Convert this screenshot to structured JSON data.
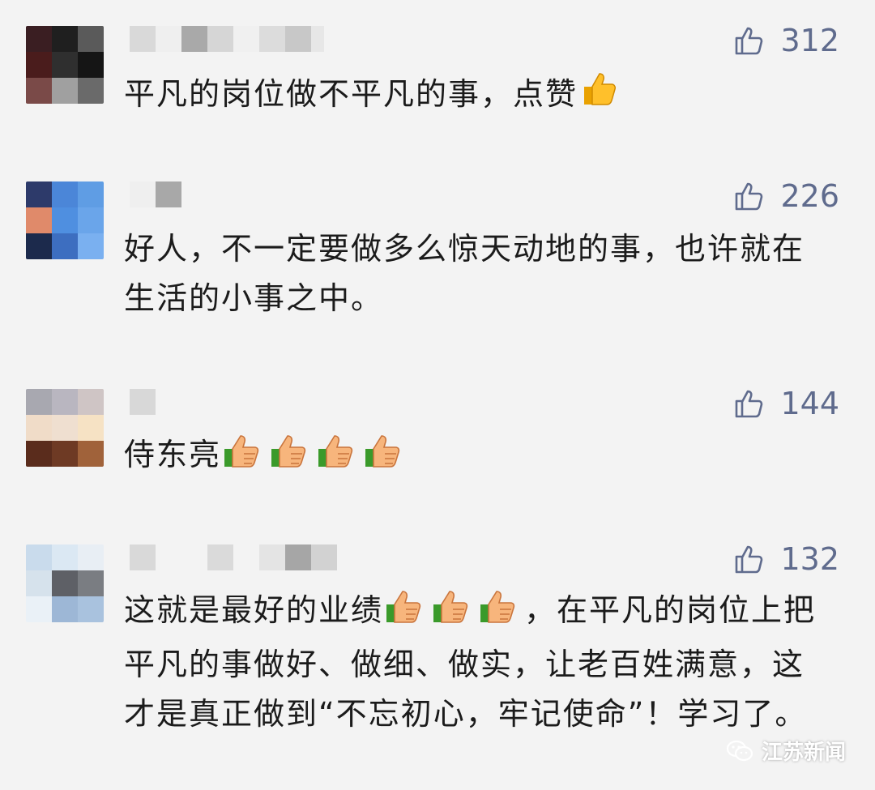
{
  "comments": [
    {
      "likes": "312",
      "text": "平凡的岗位做不平凡的事，点赞",
      "thumbs": 1,
      "thumb_style": "gold"
    },
    {
      "likes": "226",
      "text": "好人，不一定要做多么惊天动地的事，也许就在生活的小事之中。",
      "thumbs": 0
    },
    {
      "likes": "144",
      "text": "侍东亮",
      "thumbs": 4,
      "thumb_style": "cuff"
    },
    {
      "likes": "132",
      "text_before": "这就是最好的业绩",
      "thumbs": 3,
      "thumb_style": "cuff",
      "text_after": "，在平凡的岗位上把平凡的事做好、做细、做实，让老百姓满意，这才是真正做到“不忘初心，牢记使命”！学习了。"
    }
  ],
  "watermark": {
    "label": "江苏新闻",
    "icon": "wechat-icon"
  },
  "icons": {
    "like": "thumbs-up-outline-icon"
  },
  "colors": {
    "background": "#f3f3f3",
    "like_text": "#5f6b8d",
    "body_text": "#1b1b1b"
  }
}
